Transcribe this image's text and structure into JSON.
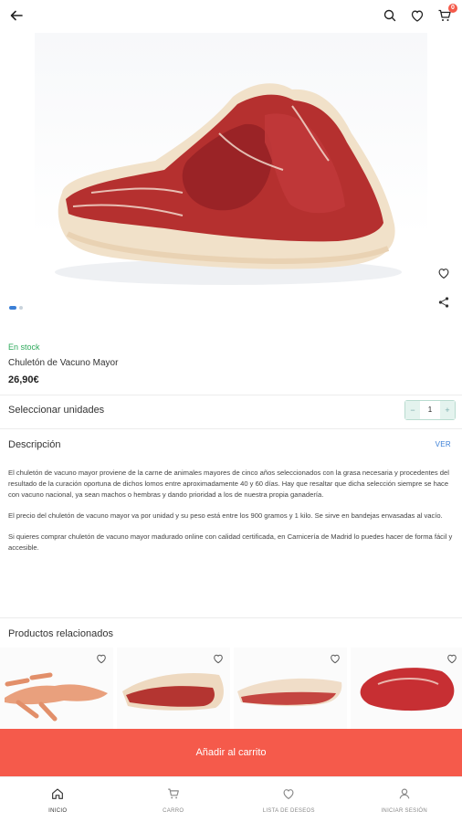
{
  "topbar": {
    "back_icon": "arrow-left-icon",
    "search_icon": "search-icon",
    "wishlist_icon": "heart-icon",
    "cart_icon": "cart-icon",
    "cart_badge": "0"
  },
  "gallery": {
    "image_alt": "Chuletón de Vacuno Mayor",
    "slide_count": 2,
    "active_slide": 1,
    "actions": [
      "heart-icon",
      "share-icon"
    ]
  },
  "product": {
    "stock": "En stock",
    "name": "Chuletón de Vacuno Mayor",
    "price": "26,90€"
  },
  "units": {
    "label": "Seleccionar unidades",
    "minus": "−",
    "quantity": "1",
    "plus": "+"
  },
  "description": {
    "title": "Descripción",
    "more_link": "VER",
    "paragraphs": [
      "El chuletón de vacuno mayor proviene de la carne de animales mayores de cinco años seleccionados con la grasa necesaria y procedentes del resultado de la curación oportuna de dichos lomos entre aproximadamente 40 y 60 días. Hay que resaltar que dicha selección siempre se hace con vacuno nacional, ya sean machos o hembras y dando prioridad a los de nuestra propia ganadería.",
      "El precio del chuletón de vacuno mayor va por unidad y su peso está entre los 900 gramos y 1 kilo. Se sirve en bandejas envasadas al vacío.",
      "Si quieres comprar chuletón de vacuno mayor madurado online con calidad certificada, en Carnicería de Madrid lo puedes hacer de forma fácil y accesible."
    ]
  },
  "related": {
    "title": "Productos relacionados"
  },
  "cta": {
    "label": "Añadir al carrito"
  },
  "bottom_nav": {
    "items": [
      {
        "label": "INICIO",
        "icon": "home-icon"
      },
      {
        "label": "CARRO",
        "icon": "cart-icon"
      },
      {
        "label": "LISTA DE DESEOS",
        "icon": "heart-icon"
      },
      {
        "label": "INICIAR SESIÓN",
        "icon": "user-icon"
      }
    ]
  },
  "colors": {
    "accent": "#f55a4b",
    "link": "#3b7fd6",
    "stock": "#2eaa5c"
  }
}
